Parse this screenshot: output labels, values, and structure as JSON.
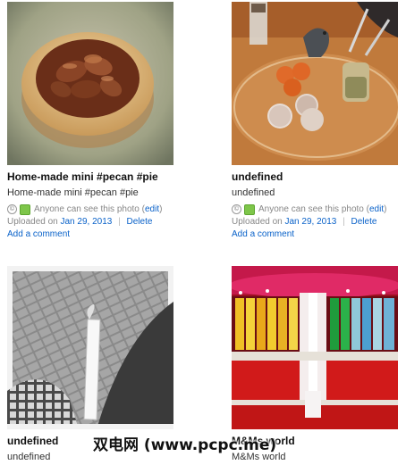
{
  "photos": [
    {
      "title": "Home-made mini #pecan #pie",
      "description": "Home-made mini #pecan #pie",
      "visibility_text": "Anyone can see this photo",
      "edit_label": "edit",
      "uploaded_label": "Uploaded on",
      "upload_date": "Jan 29, 2013",
      "delete_label": "Delete",
      "add_comment_label": "Add a comment"
    },
    {
      "title": "undefined",
      "description": "undefined",
      "visibility_text": "Anyone can see this photo",
      "edit_label": "edit",
      "uploaded_label": "Uploaded on",
      "upload_date": "Jan 29, 2013",
      "delete_label": "Delete",
      "add_comment_label": "Add a comment"
    },
    {
      "title": "undefined",
      "description": "undefined"
    },
    {
      "title": "M&Ms world",
      "description": "M&Ms world"
    }
  ],
  "watermark": "双电网 (www.pcpc.me)"
}
